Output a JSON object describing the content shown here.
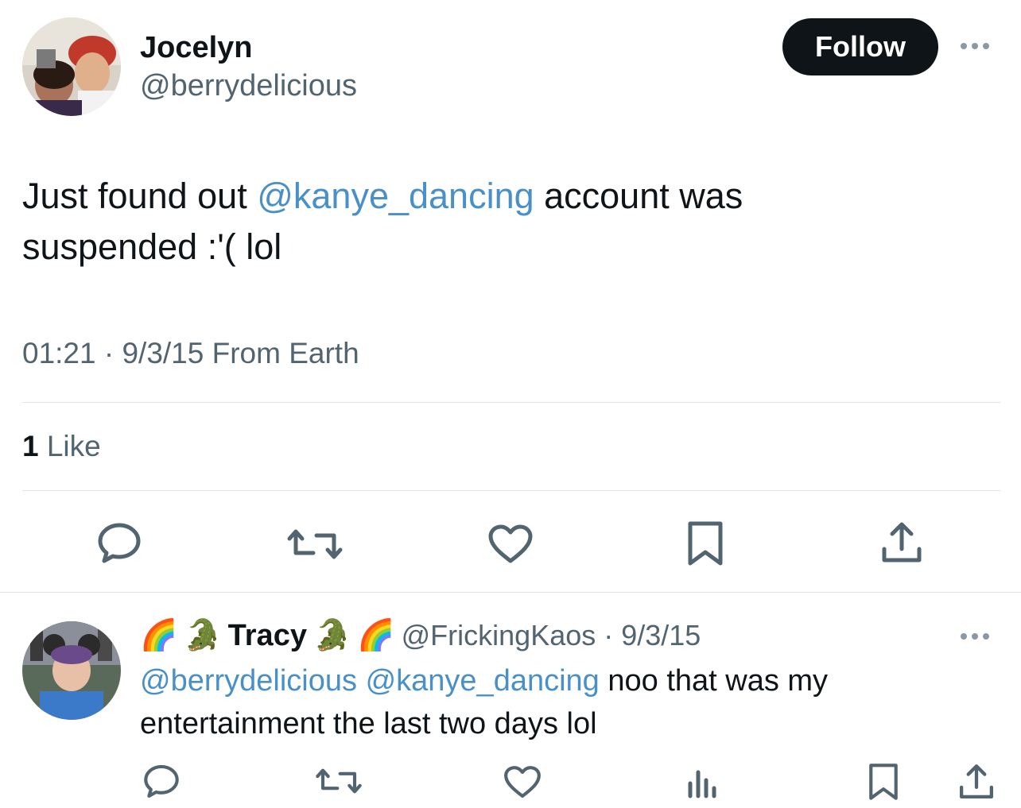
{
  "tweet": {
    "author_name": "Jocelyn",
    "author_handle": "@berrydelicious",
    "follow_label": "Follow",
    "text_part1": "Just found out ",
    "mention": "@kanye_dancing",
    "text_part2": " account was",
    "text_line2": "suspended :'( lol",
    "meta": "01:21 · 9/3/15 From Earth",
    "likes_count": "1",
    "likes_label": " Like"
  },
  "reply": {
    "name": "Tracy",
    "handle_date": "@FrickingKaos · 9/3/15",
    "mention1": "@berrydelicious",
    "mention2": "@kanye_dancing",
    "text_part1": " noo that was my",
    "text_line2": "entertainment the last two days lol",
    "emoji_rainbow": "🌈",
    "emoji_croc": "🐊"
  },
  "icons": {
    "reply": "reply-icon",
    "retweet": "retweet-icon",
    "like": "heart-icon",
    "bookmark": "bookmark-icon",
    "share": "share-icon",
    "views": "views-icon",
    "more": "more-icon"
  },
  "colors": {
    "mention": "#4a90c8",
    "secondary_text": "#536471",
    "follow_bg": "#0f1419"
  }
}
